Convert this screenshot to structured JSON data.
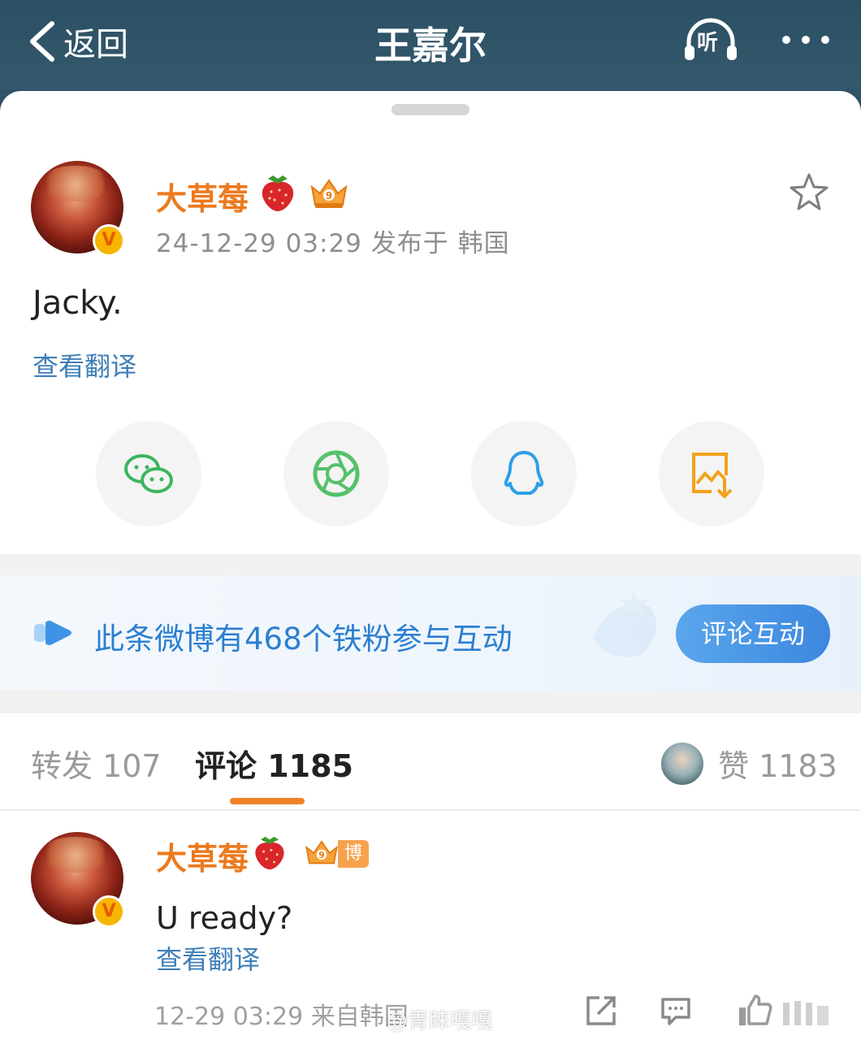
{
  "header": {
    "back_label": "返回",
    "title": "王嘉尔",
    "listen_label": "听"
  },
  "post": {
    "username": "大草莓",
    "meta": "24-12-29 03:29  发布于 韩国",
    "text": "Jacky.",
    "translate_label": "查看翻译"
  },
  "share": {
    "icons": [
      "wechat-icon",
      "moments-icon",
      "qq-icon",
      "save-image-icon"
    ]
  },
  "banner": {
    "text": "此条微博有468个铁粉参与互动",
    "button_label": "评论互动"
  },
  "tabs": {
    "repost": "转发 107",
    "comment": "评论 1185",
    "like": "赞 1183"
  },
  "comment": {
    "username": "大草莓",
    "badge_label": "博主",
    "text": "U ready?",
    "translate_label": "查看翻译",
    "meta": "12-29 03:29  来自韩国"
  },
  "watermark": "@青睐嘎嘎",
  "colors": {
    "nav_bg": "#2f5468",
    "username_orange": "#ec7a1e",
    "link_blue": "#3f7fb8",
    "tab_underline": "#ef8427",
    "banner_button": "#3d87df"
  }
}
